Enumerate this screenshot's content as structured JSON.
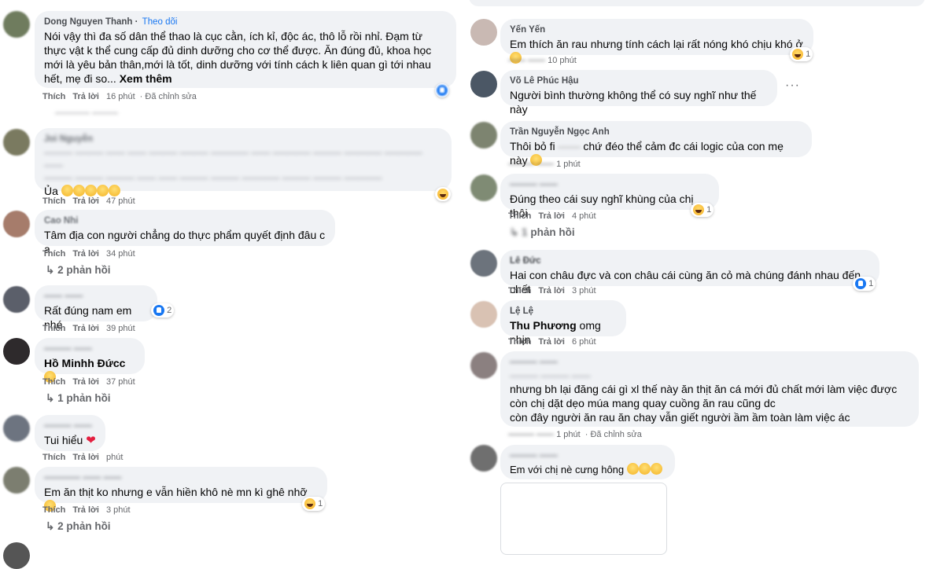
{
  "labels": {
    "like": "Thích",
    "reply": "Trả lời",
    "edited": "Đã chỉnh sửa",
    "follow": "Theo dõi",
    "see_more": "Xem thêm"
  },
  "left": [
    {
      "name": "Dong Nguyen Thanh",
      "text": "Nói vậy thì đa số dân thể thao là cục cằn, ích kỉ, độc ác, thô lỗ rồi nhỉ. Đạm từ thực vật k thể cung cấp đủ dinh dưỡng cho cơ thể được. Ăn đúng đủ, khoa học mới là yêu bản thân,mới là tốt, dinh dưỡng với tính cách k liên quan gì tới nhau hết, mẹ đi so...",
      "time": "16 phút"
    },
    {
      "name": "Joi Nguyễn",
      "text_last": "Ủa",
      "time": "47 phút"
    },
    {
      "name": "Cao Nhi",
      "text": "Tâm địa con người chẳng do thực phẩm quyết định đâu c a",
      "time": "34 phút",
      "replies": "2 phản hồi"
    },
    {
      "text": "Rất đúng nam em nhé",
      "reaction_count": "2",
      "time": "39 phút"
    },
    {
      "text": "Hồ Minhh Đứcc",
      "time": "37 phút",
      "replies": "1 phản hồi"
    },
    {
      "text": "Tui hiểu",
      "time": "phút"
    },
    {
      "text": "Em ăn thịt ko nhưng e vẫn hiền khô nè mn kì ghê nhỡ",
      "reaction_count": "1",
      "time": "3 phút",
      "replies": "2 phản hồi"
    }
  ],
  "right": [
    {
      "name": "Yến Yến",
      "text": "Em thích ăn rau nhưng tính cách lại rất nóng khó chịu khó ở",
      "reaction_count": "1",
      "time": "10 phút"
    },
    {
      "name": "Võ Lê Phúc Hậu",
      "text": "Người bình thường không thể có suy nghĩ như thế này",
      "more": "···"
    },
    {
      "name": "Trần Nguyễn Ngọc Anh",
      "text": "Thôi bỏ fi",
      "text_tail": "chứ đéo thể cảm đc cái logic của con mẹ này",
      "time": "1 phút"
    },
    {
      "text": "Đúng theo cái suy nghĩ khùng của chị thôi",
      "reaction_count": "1",
      "time": "4 phút",
      "replies": "phản hồi"
    },
    {
      "name": "Lê Đức",
      "text": "Hai con châu đực và con châu cái cùng ăn cỏ mà chúng đánh nhau đến chết",
      "reaction_count": "1",
      "time": "3 phút"
    },
    {
      "name": "Lệ Lệ",
      "tag": "Thu Phương",
      "text": "omg nhịn",
      "time": "6 phút"
    },
    {
      "text": "nhưng bh lại đăng cái gì xl thế này ăn thịt ăn cá mới đủ chất mới làm việc được còn chị dặt dẹo múa mang quay cuồng ăn rau cũng dc\ncòn đây người ăn rau ăn chay vẫn giết người ầm ầm toàn làm việc ác",
      "time": "1 phút"
    },
    {
      "text": "Em với chị nè cưng hông"
    }
  ],
  "colors": {
    "bubble": "#f0f2f5",
    "link": "#1877f2",
    "meta": "#65676b",
    "heart": "#e41e3f"
  }
}
